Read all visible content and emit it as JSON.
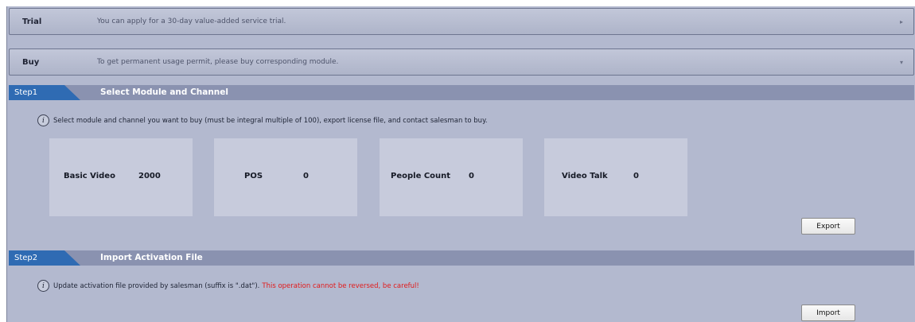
{
  "trial": {
    "title": "Trial",
    "description": "You can apply for a 30-day value-added service trial.",
    "arrow": "▸"
  },
  "buy": {
    "title": "Buy",
    "description": "To get permanent usage permit, please buy corresponding module.",
    "arrow": "▾"
  },
  "step1": {
    "badge": "Step1",
    "title": "Select Module and Channel",
    "info_icon": "i",
    "info": "Select module and channel you want to buy (must be integral multiple of 100), export license file, and contact salesman to buy.",
    "modules": [
      {
        "name": "Basic Video",
        "value": "2000"
      },
      {
        "name": "POS",
        "value": "0"
      },
      {
        "name": "People Count",
        "value": "0"
      },
      {
        "name": "Video Talk",
        "value": "0"
      }
    ],
    "export_label": "Export"
  },
  "step2": {
    "badge": "Step2",
    "title": "Import Activation File",
    "info_icon": "i",
    "info": "Update activation file provided by salesman (suffix is \".dat\").",
    "warning": "This operation cannot be reversed, be careful!",
    "import_label": "Import"
  },
  "colors": {
    "panel_bg": "#b3b9cf",
    "step_badge": "#2f6bb3",
    "step_bar": "#8a92b0",
    "warning": "#e21a1a"
  }
}
